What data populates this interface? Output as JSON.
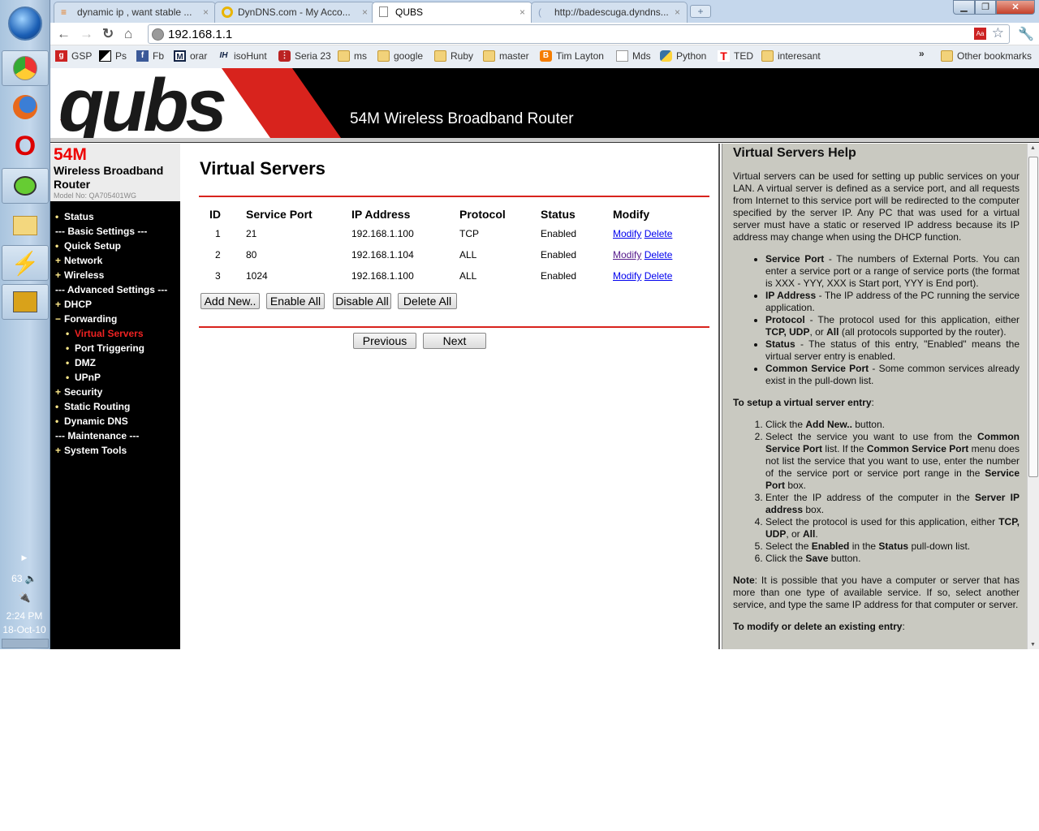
{
  "taskbar": {
    "tray_number": "63",
    "time": "2:24 PM",
    "date": "18-Oct-10"
  },
  "browser": {
    "tabs": [
      {
        "title": "dynamic ip , want stable ...",
        "active": false
      },
      {
        "title": "DynDNS.com - My Acco...",
        "active": false
      },
      {
        "title": "QUBS",
        "active": true
      },
      {
        "title": "http://badescuga.dyndns...",
        "active": false
      }
    ],
    "url": "192.168.1.1",
    "bookmarks": [
      "GSP",
      "Ps",
      "Fb",
      "orar",
      "isoHunt",
      "Seria 23",
      "ms",
      "google",
      "Ruby",
      "master",
      "Tim Layton",
      "Mds",
      "Python",
      "TED",
      "interesant"
    ],
    "overflow": "»",
    "other_bookmarks": "Other bookmarks"
  },
  "banner": {
    "logo": "qubs",
    "title": "54M Wireless Broadband Router",
    "colors": {
      "red": "#d8231d",
      "black": "#000000"
    }
  },
  "product": {
    "speed": "54M",
    "name": "Wireless Broadband Router",
    "model": "Model No: QA705401WG"
  },
  "menu": [
    {
      "bullet": "•",
      "label": "Status"
    },
    {
      "bullet": "",
      "label": "--- Basic Settings ---"
    },
    {
      "bullet": "•",
      "label": "Quick Setup"
    },
    {
      "bullet": "+",
      "label": "Network"
    },
    {
      "bullet": "+",
      "label": "Wireless"
    },
    {
      "bullet": "",
      "label": "--- Advanced Settings ---"
    },
    {
      "bullet": "+",
      "label": "DHCP"
    },
    {
      "bullet": "−",
      "label": "Forwarding"
    },
    {
      "bullet": "•",
      "label": "Virtual Servers",
      "sub": true,
      "active": true
    },
    {
      "bullet": "•",
      "label": "Port Triggering",
      "sub": true
    },
    {
      "bullet": "•",
      "label": "DMZ",
      "sub": true
    },
    {
      "bullet": "•",
      "label": "UPnP",
      "sub": true
    },
    {
      "bullet": "+",
      "label": "Security"
    },
    {
      "bullet": "•",
      "label": "Static Routing"
    },
    {
      "bullet": "•",
      "label": "Dynamic DNS"
    },
    {
      "bullet": "",
      "label": "--- Maintenance ---"
    },
    {
      "bullet": "+",
      "label": "System Tools"
    }
  ],
  "main": {
    "title": "Virtual Servers",
    "columns": [
      "ID",
      "Service Port",
      "IP Address",
      "Protocol",
      "Status",
      "Modify"
    ],
    "rows": [
      {
        "id": "1",
        "port": "21",
        "ip": "192.168.1.100",
        "protocol": "TCP",
        "status": "Enabled"
      },
      {
        "id": "2",
        "port": "80",
        "ip": "192.168.1.104",
        "protocol": "ALL",
        "status": "Enabled"
      },
      {
        "id": "3",
        "port": "1024",
        "ip": "192.168.1.100",
        "protocol": "ALL",
        "status": "Enabled"
      }
    ],
    "modify_link": "Modify",
    "delete_link": "Delete",
    "buttons": {
      "add": "Add New..",
      "enable": "Enable All",
      "disable": "Disable All",
      "delete": "Delete All",
      "previous": "Previous",
      "next": "Next"
    }
  },
  "help": {
    "title": "Virtual Servers Help",
    "intro": "Virtual servers can be used for setting up public services on your LAN. A virtual server is defined as a service port, and all requests from Internet to this service port will be redirected to the computer specified by the server IP. Any PC that was used for a virtual server must have a static or reserved IP address because its IP address may change when using the DHCP function.",
    "terms": [
      [
        {
          "b": "Service Port"
        },
        {
          "t": " - The numbers of External Ports. You can enter a service port or a range of service ports (the format is XXX - YYY, XXX is Start port, YYY is End port)."
        }
      ],
      [
        {
          "b": "IP Address"
        },
        {
          "t": " - The IP address of the PC running the service application."
        }
      ],
      [
        {
          "b": "Protocol"
        },
        {
          "t": " - The protocol used for this application, either "
        },
        {
          "b": "TCP, UDP"
        },
        {
          "t": ", or "
        },
        {
          "b": "All"
        },
        {
          "t": " (all protocols supported by the router)."
        }
      ],
      [
        {
          "b": "Status"
        },
        {
          "t": " - The status of this entry, \"Enabled\" means the virtual server entry is enabled."
        }
      ],
      [
        {
          "b": "Common Service Port"
        },
        {
          "t": " - Some common services already exist in the pull-down list."
        }
      ]
    ],
    "setup_heading": [
      {
        "b": "To setup a virtual server entry"
      },
      {
        "t": ":"
      }
    ],
    "steps": [
      [
        {
          "t": "Click the "
        },
        {
          "b": "Add New.."
        },
        {
          "t": " button."
        }
      ],
      [
        {
          "t": "Select the service you want to use from the "
        },
        {
          "b": "Common Service Port"
        },
        {
          "t": " list. If the "
        },
        {
          "b": "Common Service Port"
        },
        {
          "t": " menu does not list the service that you want to use, enter the number of the service port or service port range in the "
        },
        {
          "b": "Service Port"
        },
        {
          "t": " box."
        }
      ],
      [
        {
          "t": "Enter the IP address of the computer in the "
        },
        {
          "b": "Server IP address"
        },
        {
          "t": " box."
        }
      ],
      [
        {
          "t": "Select the protocol is used for this application, either "
        },
        {
          "b": "TCP, UDP"
        },
        {
          "t": ", or "
        },
        {
          "b": "All"
        },
        {
          "t": "."
        }
      ],
      [
        {
          "t": "Select the "
        },
        {
          "b": "Enabled"
        },
        {
          "t": " in the "
        },
        {
          "b": "Status"
        },
        {
          "t": " pull-down list."
        }
      ],
      [
        {
          "t": "Click the "
        },
        {
          "b": "Save"
        },
        {
          "t": " button."
        }
      ]
    ],
    "note": [
      {
        "b": "Note"
      },
      {
        "t": ": It is possible that you have a computer or server that has more than one type of available service. If so, select another service, and type the same IP address for that computer or server."
      }
    ],
    "modify_heading": [
      {
        "b": "To modify or delete an existing entry"
      },
      {
        "t": ":"
      }
    ]
  }
}
